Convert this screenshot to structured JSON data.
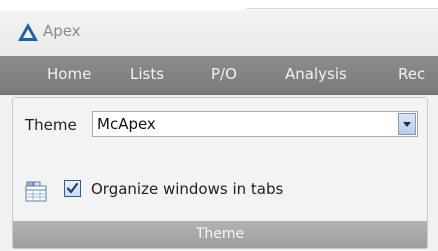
{
  "window": {
    "title": "Apex",
    "logo_icon": "apex-triangle-logo",
    "logo_color": "#1f5fb0"
  },
  "menu": {
    "items": [
      {
        "label": "Home"
      },
      {
        "label": "Lists"
      },
      {
        "label": "P/O"
      },
      {
        "label": "Analysis"
      },
      {
        "label": "Rec"
      }
    ]
  },
  "ribbon": {
    "group_title": "Theme",
    "theme_label": "Theme",
    "theme_selected": "McApex",
    "organize_tabs": {
      "label": "Organize windows in tabs",
      "checked": true,
      "icon": "tabs-layout-icon"
    }
  },
  "colors": {
    "menubar": "#858585",
    "group_footer": "#a8a8a8",
    "checkbox_check": "#1f3f7a"
  }
}
